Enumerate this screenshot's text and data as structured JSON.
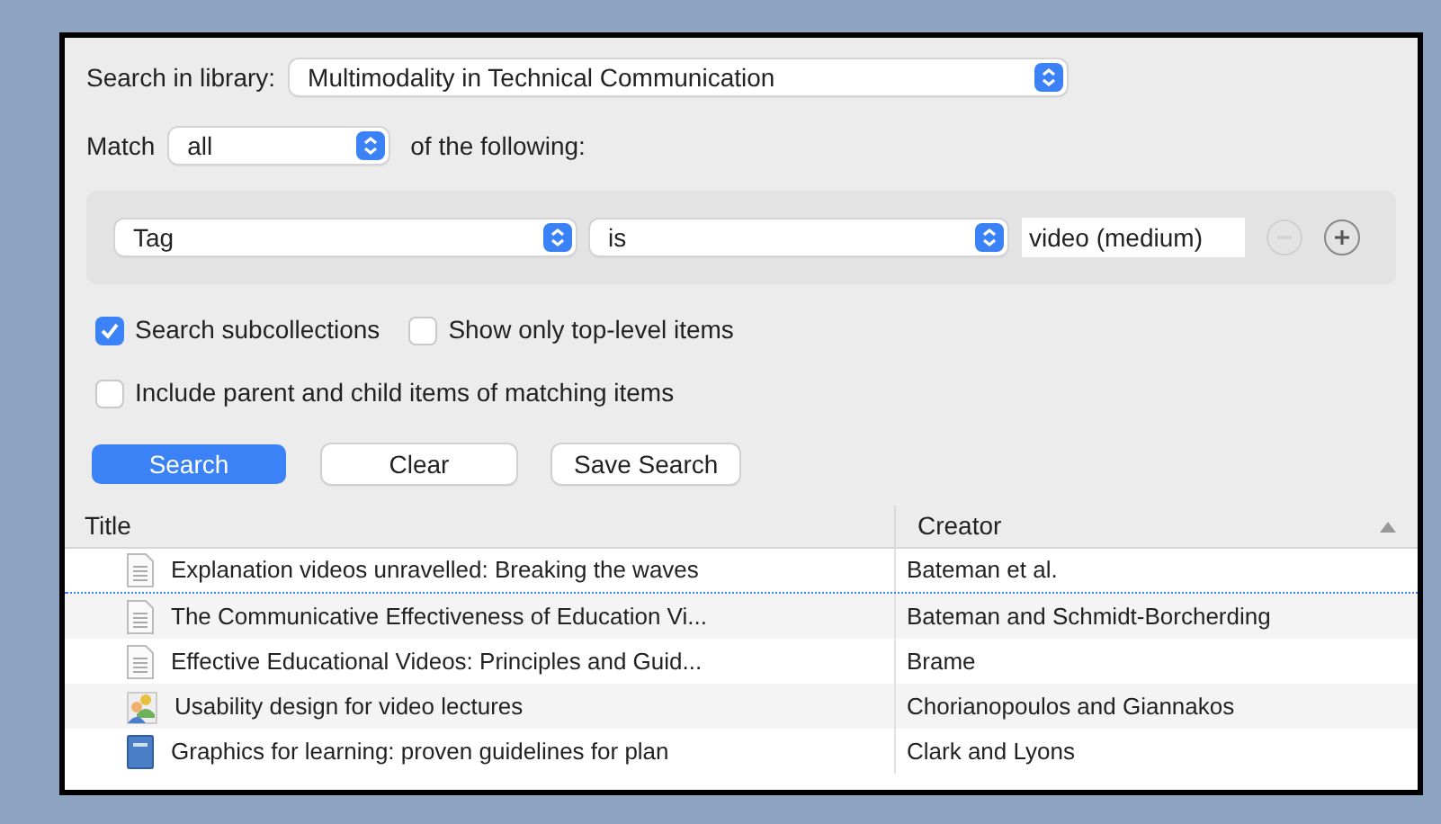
{
  "library": {
    "label": "Search in library:",
    "value": "Multimodality in Technical Communication"
  },
  "match": {
    "label": "Match",
    "value": "all",
    "suffix": "of the following:"
  },
  "condition": {
    "field": "Tag",
    "operator": "is",
    "value": "video (medium)",
    "remove_disabled": true
  },
  "options": [
    {
      "label": "Search subcollections",
      "checked": true
    },
    {
      "label": "Show only top-level items",
      "checked": false
    },
    {
      "label": "Include parent and child items of matching items",
      "checked": false
    }
  ],
  "buttons": [
    {
      "label": "Search",
      "primary": true
    },
    {
      "label": "Clear",
      "primary": false
    },
    {
      "label": "Save Search",
      "primary": false
    }
  ],
  "table": {
    "columns": [
      {
        "label": "Title",
        "sorted": false
      },
      {
        "label": "Creator",
        "sorted": true
      }
    ],
    "rows": [
      {
        "kind": "document",
        "title": "Explanation videos unravelled: Breaking the waves",
        "creator": "Bateman et al.",
        "drop_target": true
      },
      {
        "kind": "document",
        "title": "The Communicative Effectiveness of Education Vi...",
        "creator": "Bateman and Schmidt-Borcherding",
        "drop_target": false
      },
      {
        "kind": "document",
        "title": "Effective Educational Videos: Principles and Guid...",
        "creator": "Brame",
        "drop_target": false
      },
      {
        "kind": "presentation",
        "title": "Usability design for video lectures",
        "creator": "Chorianopoulos and Giannakos",
        "drop_target": false
      },
      {
        "kind": "book",
        "title": "Graphics for learning: proven guidelines for plan",
        "creator": "Clark and Lyons",
        "drop_target": false
      }
    ]
  }
}
